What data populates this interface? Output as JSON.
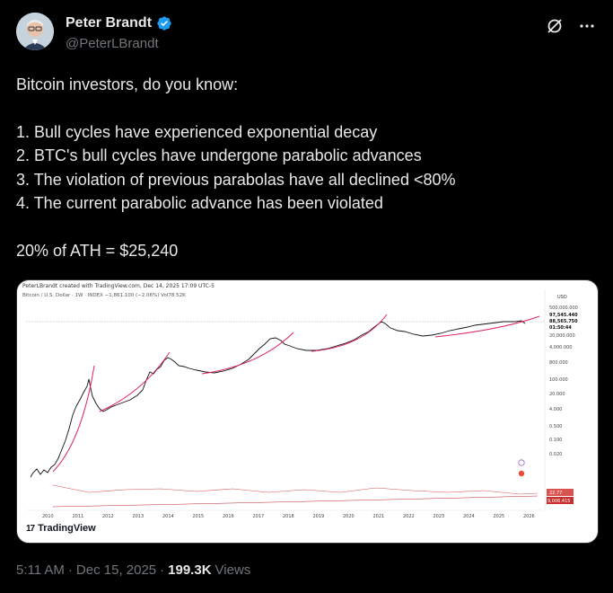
{
  "author": {
    "name": "Peter Brandt",
    "handle": "@PeterLBrandt"
  },
  "tweet": {
    "lines": [
      "Bitcoin investors, do you know:",
      "1. Bull cycles have experienced exponential decay",
      "2. BTC's bull cycles have undergone parabolic advances",
      "3. The violation of previous parabolas have all declined <80%",
      "4. The current parabolic advance has been violated",
      "20% of ATH = $25,240"
    ]
  },
  "chart": {
    "created_by": "PeterLBrandt created with TradingView.com, Dec 14, 2025 17:09 UTC-5",
    "symbol_line": "Bitcoin / U.S. Dollar · 1W · INDEX   −1,861.100 (−2.06%)   Vol78.52K",
    "currency": "USD",
    "price_labels": [
      "500,000.000",
      "97,545.440",
      "88,565.750",
      "01:50:44",
      "20,000.000",
      "4,000.000",
      "800.000",
      "100.000",
      "20.000",
      "4.000",
      "0.500",
      "0.100",
      "0.020"
    ],
    "indicator_labels": [
      "22.77",
      "9,006.415"
    ],
    "year_labels": [
      "2010",
      "2011",
      "2012",
      "2013",
      "2014",
      "2015",
      "2016",
      "2017",
      "2018",
      "2019",
      "2020",
      "2021",
      "2022",
      "2023",
      "2024",
      "2025",
      "2026"
    ],
    "brand": "TradingView",
    "colors": {
      "price_line": "#111111",
      "parabola": "#e0245e",
      "indicator": "#d9534f"
    }
  },
  "meta": {
    "time": "5:11 AM",
    "date": "Dec 15, 2025",
    "views_count": "199.3K",
    "views_label": "Views"
  },
  "icons": [
    "verified-badge-icon",
    "grok-icon",
    "more-icon",
    "tradingview-logo-icon"
  ],
  "colors": {
    "background": "#000000",
    "text": "#e7e9ea",
    "muted": "#71767b",
    "verified": "#1d9bf0"
  }
}
